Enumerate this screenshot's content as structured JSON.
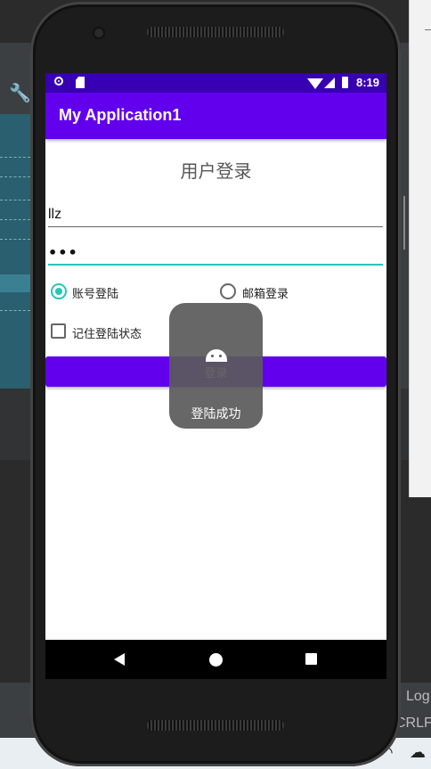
{
  "ide": {
    "log_label": "Log",
    "crlf_label": "CRLF"
  },
  "status_bar": {
    "time": "8:19",
    "icons": [
      "notification-circle-icon",
      "sd-card-icon",
      "wifi-icon",
      "signal-icon",
      "battery-icon"
    ]
  },
  "app_bar": {
    "title": "My Application1"
  },
  "login": {
    "title": "用户登录",
    "username_value": "llz",
    "password_value": "•••",
    "radio_account_label": "账号登陆",
    "radio_account_checked": true,
    "radio_email_label": "邮箱登录",
    "radio_email_checked": false,
    "remember_label": "记住登陆状态",
    "remember_checked": false,
    "button_label": "登录"
  },
  "toast": {
    "message": "登陆成功"
  },
  "colors": {
    "primary": "#6200ee",
    "primary_dark": "#3700b3",
    "accent": "#26c6b9"
  }
}
